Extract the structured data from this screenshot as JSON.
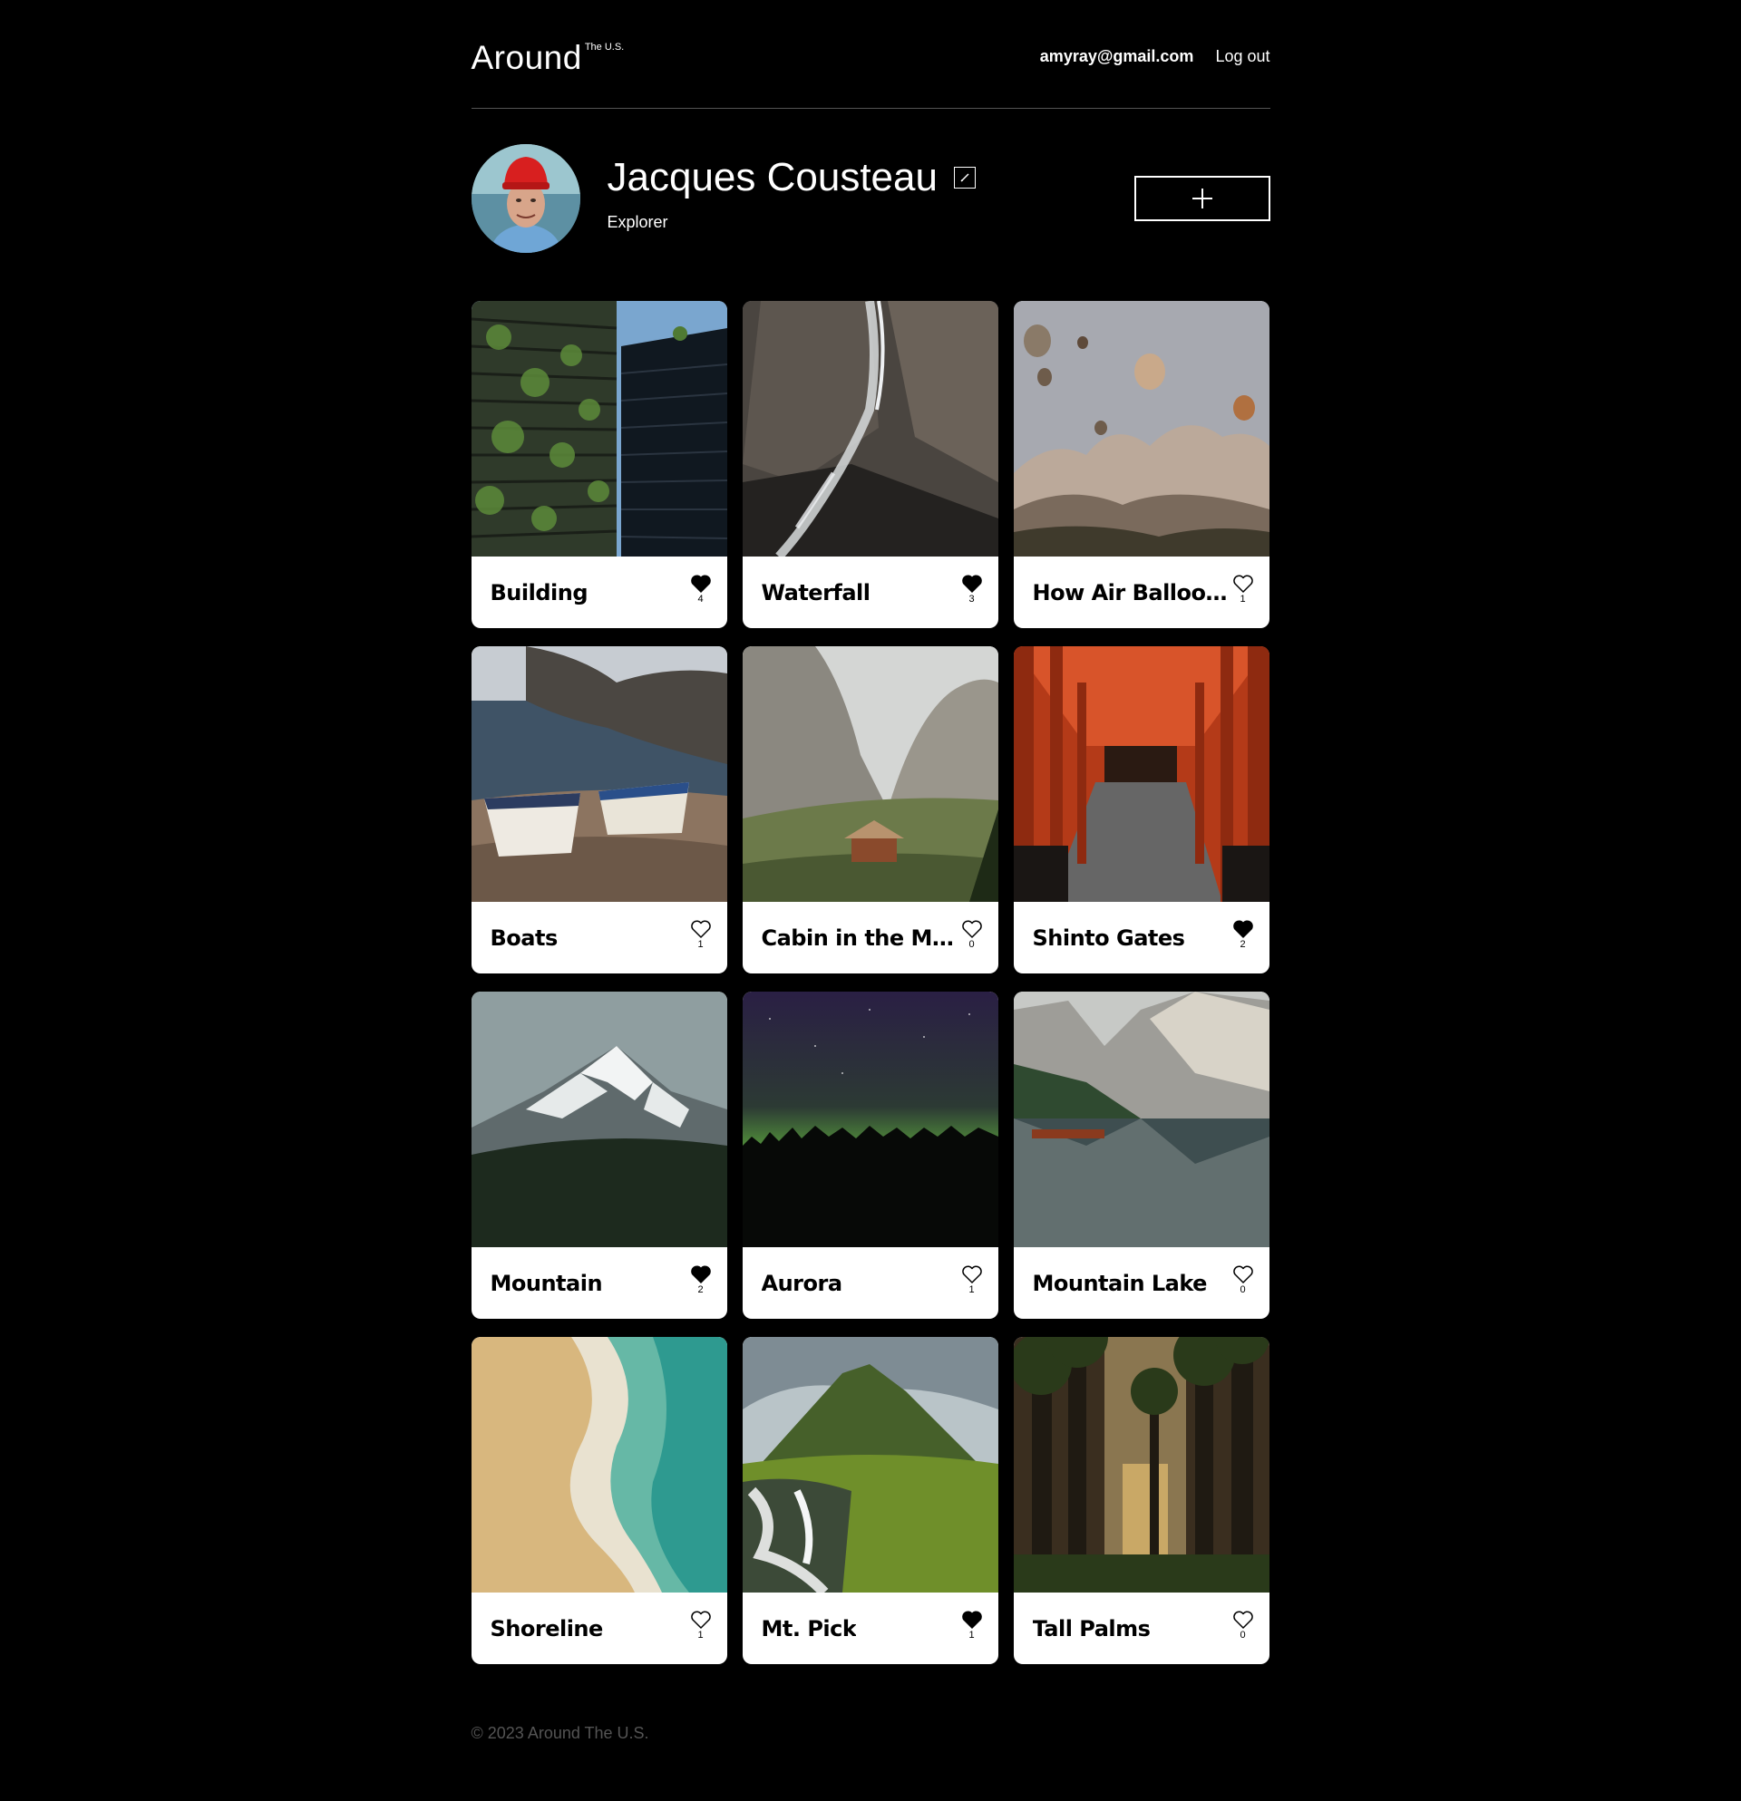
{
  "header": {
    "logo": "Around",
    "logo_sup": "The U.S.",
    "email": "amyray@gmail.com",
    "logout": "Log out"
  },
  "profile": {
    "name": "Jacques Cousteau",
    "about": "Explorer"
  },
  "cards": [
    {
      "title": "Building",
      "likes": "4",
      "liked": true
    },
    {
      "title": "Waterfall",
      "likes": "3",
      "liked": true
    },
    {
      "title": "How Air Balloons",
      "likes": "1",
      "liked": false
    },
    {
      "title": "Boats",
      "likes": "1",
      "liked": false
    },
    {
      "title": "Cabin in the Mou...",
      "likes": "0",
      "liked": false
    },
    {
      "title": "Shinto Gates",
      "likes": "2",
      "liked": true
    },
    {
      "title": "Mountain",
      "likes": "2",
      "liked": true
    },
    {
      "title": "Aurora",
      "likes": "1",
      "liked": false
    },
    {
      "title": "Mountain Lake",
      "likes": "0",
      "liked": false
    },
    {
      "title": "Shoreline",
      "likes": "1",
      "liked": false
    },
    {
      "title": "Mt. Pick",
      "likes": "1",
      "liked": true
    },
    {
      "title": "Tall Palms",
      "likes": "0",
      "liked": false
    }
  ],
  "footer": {
    "copyright": "© 2023 Around The U.S."
  },
  "icons": {
    "edit": "pencil-icon",
    "add": "plus-icon",
    "like": "heart-icon"
  }
}
